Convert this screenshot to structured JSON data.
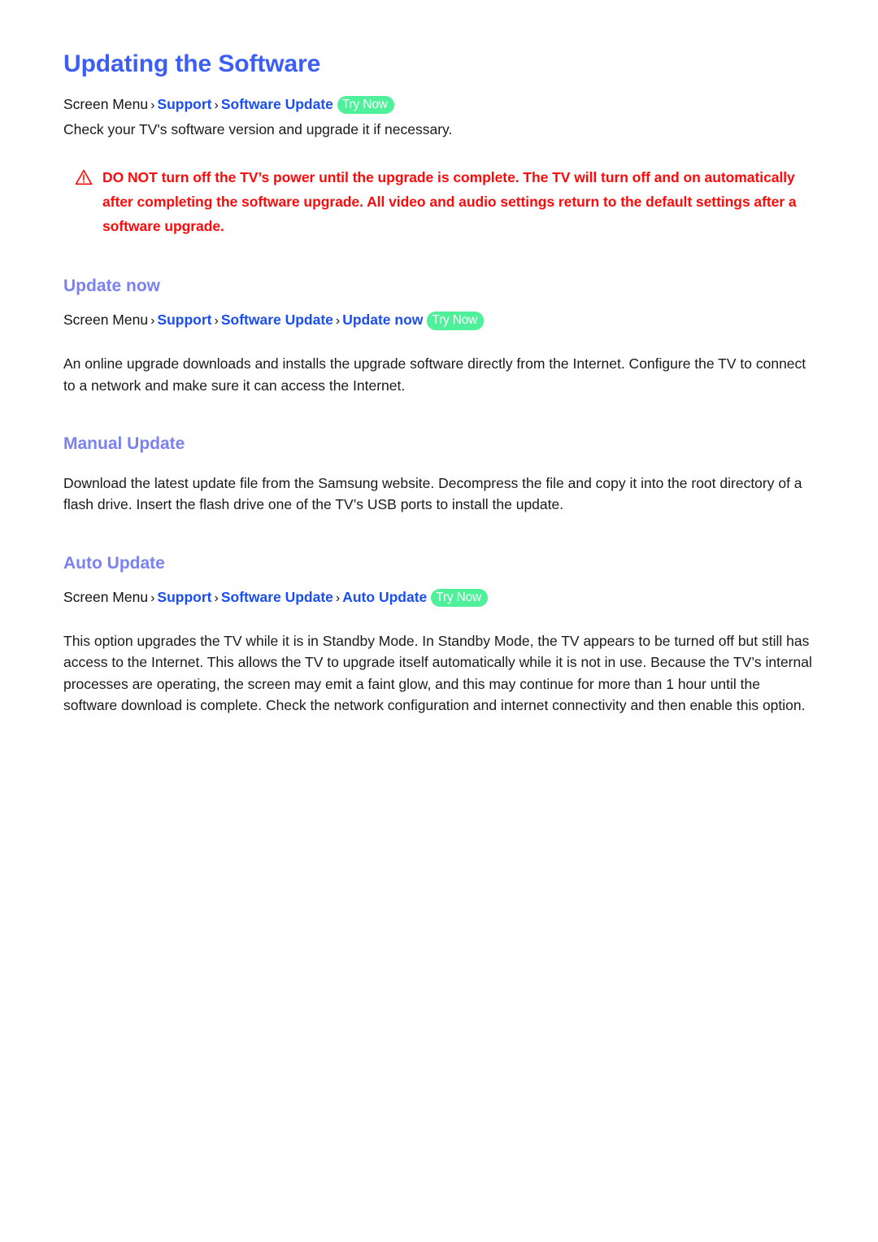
{
  "page": {
    "title": "Updating the Software",
    "try_now_label": "Try Now",
    "separator": "›",
    "colors": {
      "title_blue": "#3c5ef5",
      "link_blue": "#1a4ef0",
      "heading_violet": "#7a82f0",
      "warning_red": "#fb0b0b",
      "badge_green": "#4ef09a",
      "body_black": "#1a1a1a",
      "background": "#ffffff"
    }
  },
  "intro": {
    "breadcrumb": {
      "root": "Screen Menu",
      "links": [
        "Support",
        "Software Update"
      ]
    },
    "paragraph": "Check your TV's software version and upgrade it if necessary."
  },
  "warning": {
    "icon": "warning-triangle-icon",
    "text": "DO NOT turn off the TV’s power until the upgrade is complete. The TV will turn off and on automatically after completing the software upgrade. All video and audio settings return to the default settings after a software upgrade."
  },
  "sections": [
    {
      "id": "update-now",
      "heading": "Update now",
      "breadcrumb": {
        "root": "Screen Menu",
        "links": [
          "Support",
          "Software Update",
          "Update now"
        ]
      },
      "paragraph": "An online upgrade downloads and installs the upgrade software directly from the Internet. Configure the TV to connect to a network and make sure it can access the Internet."
    },
    {
      "id": "manual-update",
      "heading": "Manual Update",
      "breadcrumb": null,
      "paragraph": "Download the latest update file from the Samsung website. Decompress the file and copy it into the root directory of a flash drive. Insert the flash drive one of the TV’s USB ports to install the update."
    },
    {
      "id": "auto-update",
      "heading": "Auto Update",
      "breadcrumb": {
        "root": "Screen Menu",
        "links": [
          "Support",
          "Software Update",
          "Auto Update"
        ]
      },
      "paragraph": "This option upgrades the TV while it is in Standby Mode. In Standby Mode, the TV appears to be turned off but still has access to the Internet. This allows the TV to upgrade itself automatically while it is not in use. Because the TV’s internal processes are operating, the screen may emit a faint glow, and this may continue for more than 1 hour until the software download is complete. Check the network configuration and internet connectivity and then enable this option."
    }
  ]
}
